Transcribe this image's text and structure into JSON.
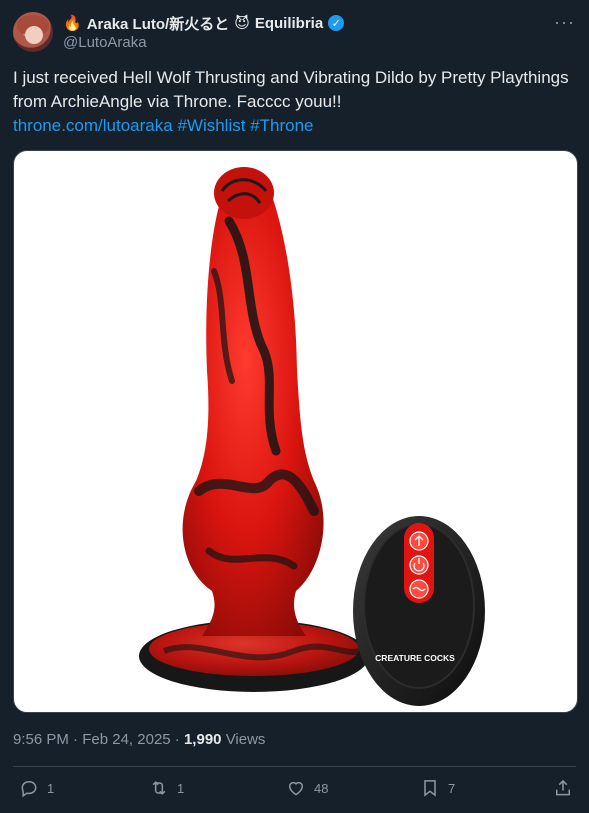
{
  "author": {
    "name_prefix_emoji": "🔥",
    "display_name": "Araka Luto/新火ると",
    "name_suffix_emoji": "😈",
    "display_name_suffix": "Equilibria",
    "verified_mark": "✓",
    "handle": "@LutoAraka"
  },
  "more_menu": "···",
  "tweet": {
    "text": "I just received Hell Wolf Thrusting and Vibrating Dildo by Pretty Playthings from ArchieAngle via Throne. Facccc youu!!",
    "link": "throne.com/lutoaraka",
    "hashtags": [
      "#Wishlist",
      "#Throne"
    ]
  },
  "media": {
    "remote_text": "CREATURE COCKS",
    "colors": {
      "red": "#e01512",
      "black": "#141414"
    }
  },
  "meta": {
    "time": "9:56 PM",
    "date": "Feb 24, 2025",
    "views": "1,990",
    "views_label": "Views"
  },
  "actions": {
    "replies": "1",
    "retweets": "1",
    "likes": "48",
    "bookmarks": "7"
  },
  "icons": [
    "reply-icon",
    "retweet-icon",
    "like-icon",
    "bookmark-icon",
    "share-icon",
    "verified-icon",
    "more-icon"
  ]
}
